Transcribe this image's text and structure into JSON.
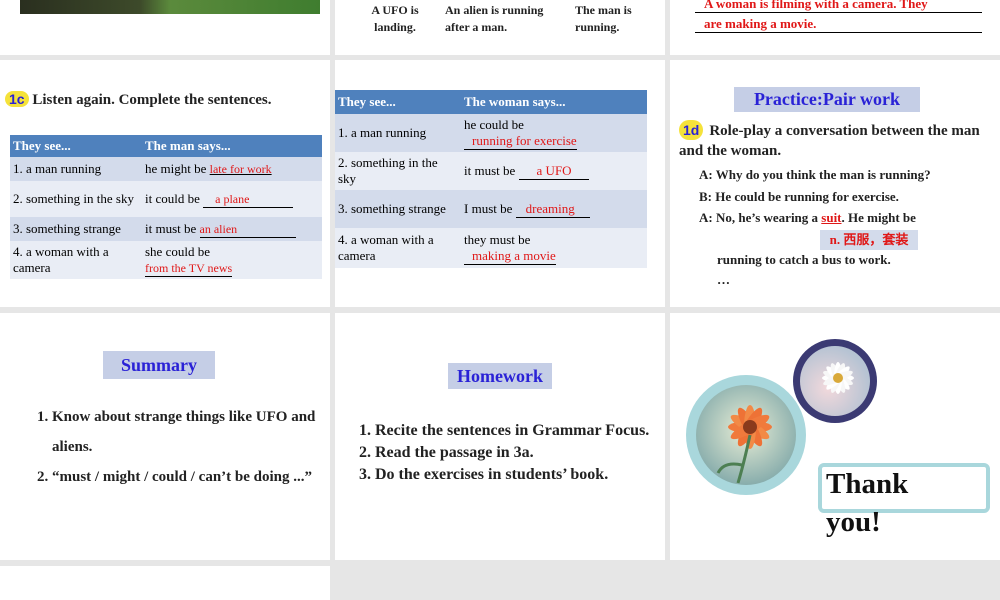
{
  "slide1": {},
  "slide2": {
    "captions": [
      "A UFO is landing.",
      "An alien is running after a man.",
      "The man is running."
    ]
  },
  "slide3": {
    "line1": "A woman is filming with a camera. They",
    "line2": "are making a movie."
  },
  "slide4": {
    "badge": "1c",
    "instruction": "Listen again. Complete the sentences.",
    "headers": [
      "They see...",
      "The man says..."
    ],
    "rows": [
      {
        "see": "1. a man running",
        "says": "he might be",
        "answer": "late for work"
      },
      {
        "see": "2. something in the sky",
        "says": "it could be",
        "answer": "a plane"
      },
      {
        "see": "3. something strange",
        "says": "it must be",
        "answer": "an alien"
      },
      {
        "see": "4. a woman with a camera",
        "says": "she could be",
        "answer": "from the TV news"
      }
    ]
  },
  "slide5": {
    "headers": [
      "They see...",
      "The woman says..."
    ],
    "rows": [
      {
        "see": "1. a man running",
        "says": "he could be",
        "answer": "running for exercise"
      },
      {
        "see": "2. something in the sky",
        "says": "it must be",
        "answer": "a UFO"
      },
      {
        "see": "3. something strange",
        "says": "I must be",
        "answer": "dreaming"
      },
      {
        "see": "4. a woman with a camera",
        "says": "they must be",
        "answer": "making a movie"
      }
    ]
  },
  "slide6": {
    "title": "Practice:Pair work",
    "badge": "1d",
    "instruction": "Role-play a conversation between the man and the woman.",
    "line_a1": "A: Why do you think the man is running?",
    "line_b": "B: He could be running for exercise.",
    "line_a2_pre": "A: No, he’s wearing a ",
    "line_a2_word": "suit",
    "line_a2_post": ". He might be",
    "note": "n. 西服，套装",
    "line_cont": "running to catch a bus to work.",
    "ellipsis": "…"
  },
  "slide7": {
    "title": "Summary",
    "items": [
      "Know about strange things like UFO and aliens.",
      "“must / might / could / can’t be doing ...”"
    ]
  },
  "slide8": {
    "title": "Homework",
    "items": [
      "Recite the sentences in Grammar Focus.",
      "Read the passage in 3a.",
      "Do the exercises in students’ book."
    ]
  },
  "slide9": {
    "thanks": "Thank you!"
  },
  "colors": {
    "accent_blue": "#2a22d6",
    "answer_red": "#e01818",
    "table_header": "#4f81bd"
  }
}
